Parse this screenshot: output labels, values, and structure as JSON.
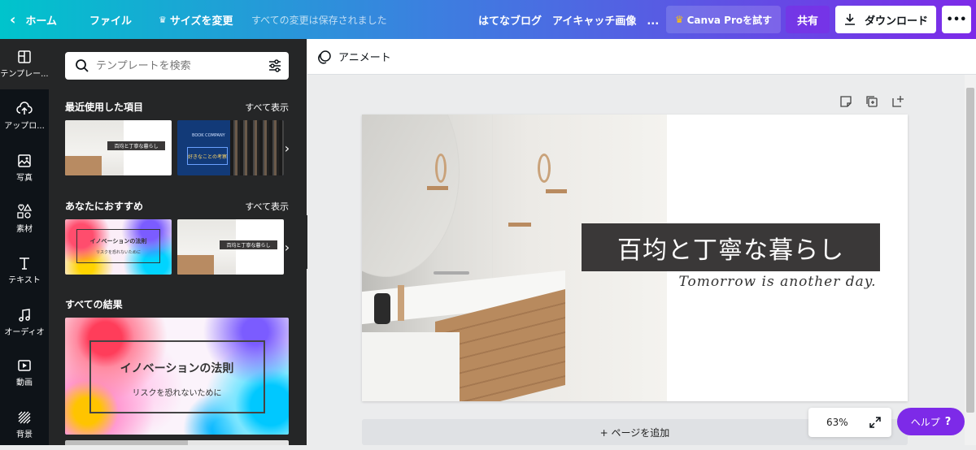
{
  "topbar": {
    "home": "ホーム",
    "file": "ファイル",
    "resize": "サイズを変更",
    "saved_status": "すべての変更は保存されました",
    "doc_title": "はてなブログ　アイキャッチ画像　...",
    "try_pro": "Canva Proを試す",
    "share": "共有",
    "download": "ダウンロード",
    "more": "•••"
  },
  "rail": [
    {
      "label": "テンプレー...",
      "icon": "template-icon"
    },
    {
      "label": "アップロ...",
      "icon": "upload-icon"
    },
    {
      "label": "写真",
      "icon": "photo-icon"
    },
    {
      "label": "素材",
      "icon": "elements-icon"
    },
    {
      "label": "テキスト",
      "icon": "text-icon"
    },
    {
      "label": "オーディオ",
      "icon": "audio-icon"
    },
    {
      "label": "動画",
      "icon": "video-icon"
    },
    {
      "label": "背景",
      "icon": "background-icon"
    }
  ],
  "panel": {
    "search_placeholder": "テンプレートを検索",
    "recent_title": "最近使用した項目",
    "recommended_title": "あなたにおすすめ",
    "all_results_title": "すべての結果",
    "see_all": "すべて表示",
    "thumb_bath_text": "百均と丁寧な暮らし",
    "thumb_book_header": "BOOK COMPANY",
    "thumb_book_text": "好きなことの考察",
    "thumb_innov_title": "イノベーションの法則",
    "thumb_innov_sub": "リスクを恐れないために"
  },
  "toolbar": {
    "animate": "アニメート"
  },
  "design": {
    "title": "百均と丁寧な暮らし",
    "subtitle": "Tomorrow is another day."
  },
  "footer": {
    "add_page": "+ ページを追加",
    "zoom": "63%",
    "help": "ヘルプ"
  },
  "colors": {
    "accent_purple": "#7d2ae8",
    "dark_panel": "#252627",
    "rail": "#0e1318",
    "title_box": "#3a3838"
  }
}
